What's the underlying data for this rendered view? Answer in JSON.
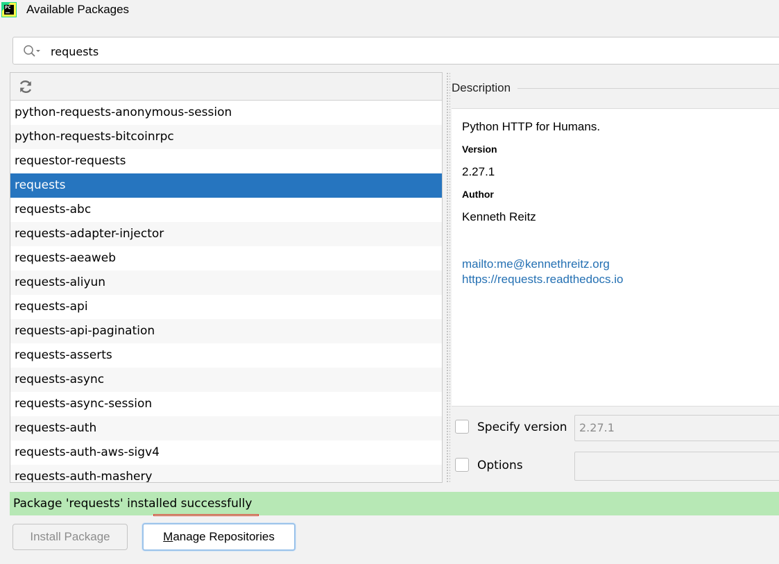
{
  "window": {
    "title": "Available Packages"
  },
  "search": {
    "value": "requests",
    "icon": "search-icon"
  },
  "list": {
    "refresh_icon": "refresh-icon",
    "selected_index": 3,
    "items": [
      "python-requests-anonymous-session",
      "python-requests-bitcoinrpc",
      "requestor-requests",
      "requests",
      "requests-abc",
      "requests-adapter-injector",
      "requests-aeaweb",
      "requests-aliyun",
      "requests-api",
      "requests-api-pagination",
      "requests-asserts",
      "requests-async",
      "requests-async-session",
      "requests-auth",
      "requests-auth-aws-sigv4",
      "requests-auth-mashery"
    ]
  },
  "description": {
    "header": "Description",
    "summary": "Python HTTP for Humans.",
    "version_label": "Version",
    "version": "2.27.1",
    "author_label": "Author",
    "author": "Kenneth Reitz",
    "email_link": "mailto:me@kennethreitz.org",
    "home_link": "https://requests.readthedocs.io"
  },
  "options": {
    "specify_version_label": "Specify version",
    "specify_version_value": "2.27.1",
    "options_label": "Options",
    "options_value": ""
  },
  "status": {
    "message": "Package 'requests' installed successfully"
  },
  "buttons": {
    "install_label": "Install Package",
    "manage_mnemonic": "M",
    "manage_rest": "anage Repositories"
  },
  "colors": {
    "selection": "#2675bf",
    "status_background": "#b7e8b5",
    "link": "#2470b3",
    "highlight_underline": "#e53935"
  }
}
